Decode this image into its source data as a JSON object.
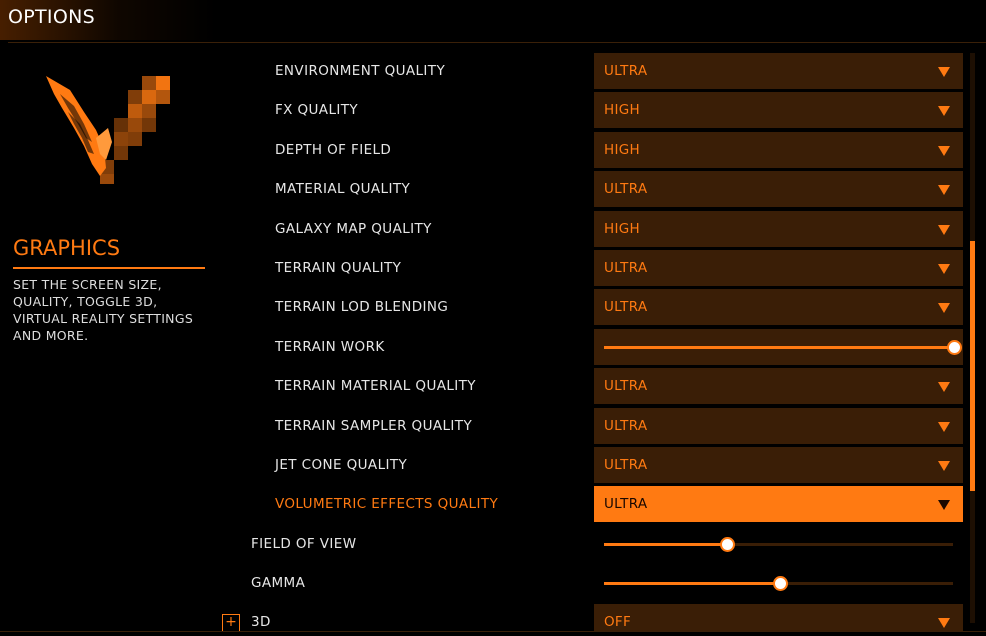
{
  "header": {
    "title": "OPTIONS"
  },
  "section": {
    "title": "GRAPHICS",
    "description": "SET THE SCREEN SIZE, QUALITY, TOGGLE 3D, VIRTUAL REALITY SETTINGS AND MORE."
  },
  "settings": [
    {
      "label": "ENVIRONMENT QUALITY",
      "type": "dropdown",
      "value": "ULTRA"
    },
    {
      "label": "FX QUALITY",
      "type": "dropdown",
      "value": "HIGH"
    },
    {
      "label": "DEPTH OF FIELD",
      "type": "dropdown",
      "value": "HIGH"
    },
    {
      "label": "MATERIAL QUALITY",
      "type": "dropdown",
      "value": "ULTRA"
    },
    {
      "label": "GALAXY MAP QUALITY",
      "type": "dropdown",
      "value": "HIGH"
    },
    {
      "label": "TERRAIN QUALITY",
      "type": "dropdown",
      "value": "ULTRA"
    },
    {
      "label": "TERRAIN LOD BLENDING",
      "type": "dropdown",
      "value": "ULTRA"
    },
    {
      "label": "TERRAIN WORK",
      "type": "slider",
      "level": 1.0
    },
    {
      "label": "TERRAIN MATERIAL QUALITY",
      "type": "dropdown",
      "value": "ULTRA"
    },
    {
      "label": "TERRAIN SAMPLER QUALITY",
      "type": "dropdown",
      "value": "ULTRA"
    },
    {
      "label": "JET CONE QUALITY",
      "type": "dropdown",
      "value": "ULTRA"
    },
    {
      "label": "VOLUMETRIC EFFECTS QUALITY",
      "type": "dropdown",
      "value": "ULTRA",
      "selected": true
    },
    {
      "label": "FIELD OF VIEW",
      "type": "slider",
      "level": 0.35
    },
    {
      "label": "GAMMA",
      "type": "slider",
      "level": 0.5
    },
    {
      "label": "3D",
      "type": "dropdown",
      "value": "OFF",
      "expandable": true
    }
  ],
  "colors": {
    "accent": "#ff7a12",
    "control_bg": "#3a1e06",
    "background": "#000000"
  },
  "icons": {
    "logo": "elite-wings-logo-icon",
    "dropdown": "caret-down-icon",
    "expand": "plus-box-icon"
  }
}
